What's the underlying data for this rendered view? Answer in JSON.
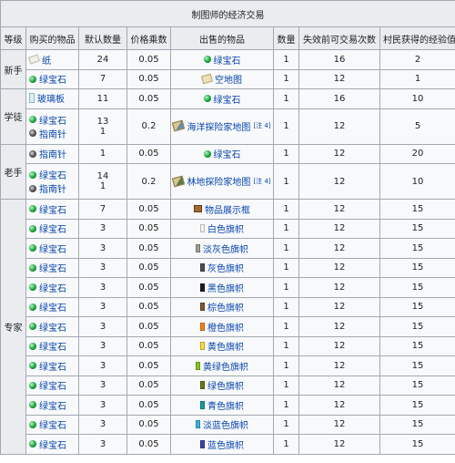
{
  "caption": "制图师的经济交易",
  "headers": [
    "等级",
    "购买的物品",
    "默认数量",
    "价格乘数",
    "出售的物品",
    "数量",
    "失效前可交易次数",
    "村民获得的经验值"
  ],
  "rows": [
    {
      "level": "新手",
      "buy": [
        {
          "name": "纸",
          "icon": "paper-icon",
          "qty": "24"
        }
      ],
      "mult": "0.05",
      "sell": {
        "name": "绿宝石",
        "icon": "emerald-icon"
      },
      "sell_qty": "1",
      "max_uses": "16",
      "xp": "2"
    },
    {
      "buy": [
        {
          "name": "绿宝石",
          "icon": "emerald-icon",
          "qty": "7"
        }
      ],
      "mult": "0.05",
      "sell": {
        "name": "空地图",
        "icon": "empty-map-icon"
      },
      "sell_qty": "1",
      "max_uses": "12",
      "xp": "1"
    },
    {
      "level": "学徒",
      "buy": [
        {
          "name": "玻璃板",
          "icon": "glass-pane-icon",
          "qty": "11"
        }
      ],
      "mult": "0.05",
      "sell": {
        "name": "绿宝石",
        "icon": "emerald-icon"
      },
      "sell_qty": "1",
      "max_uses": "16",
      "xp": "10"
    },
    {
      "buy": [
        {
          "name": "绿宝石",
          "icon": "emerald-icon",
          "qty": "13"
        },
        {
          "name": "指南针",
          "icon": "compass-icon",
          "qty": "1"
        }
      ],
      "mult": "0.2",
      "sell": {
        "name": "海洋探险家地图",
        "icon": "ocean-explorer-map-icon",
        "note": "[注 4]"
      },
      "sell_qty": "1",
      "max_uses": "12",
      "xp": "5"
    },
    {
      "level": "老手",
      "buy": [
        {
          "name": "指南针",
          "icon": "compass-icon",
          "qty": "1"
        }
      ],
      "mult": "0.05",
      "sell": {
        "name": "绿宝石",
        "icon": "emerald-icon"
      },
      "sell_qty": "1",
      "max_uses": "12",
      "xp": "20"
    },
    {
      "buy": [
        {
          "name": "绿宝石",
          "icon": "emerald-icon",
          "qty": "14"
        },
        {
          "name": "指南针",
          "icon": "compass-icon",
          "qty": "1"
        }
      ],
      "mult": "0.2",
      "sell": {
        "name": "林地探险家地图",
        "icon": "woodland-explorer-map-icon",
        "note": "[注 4]"
      },
      "sell_qty": "1",
      "max_uses": "12",
      "xp": "10"
    },
    {
      "level": "专家",
      "buy": [
        {
          "name": "绿宝石",
          "icon": "emerald-icon",
          "qty": "7"
        }
      ],
      "mult": "0.05",
      "sell": {
        "name": "物品展示框",
        "icon": "item-frame-icon"
      },
      "sell_qty": "1",
      "max_uses": "12",
      "xp": "15"
    },
    {
      "buy": [
        {
          "name": "绿宝石",
          "icon": "emerald-icon",
          "qty": "3"
        }
      ],
      "mult": "0.05",
      "sell": {
        "name": "白色旗帜",
        "icon": "white-banner-icon",
        "color": "#f4f4f4"
      },
      "sell_qty": "1",
      "max_uses": "12",
      "xp": "15"
    },
    {
      "buy": [
        {
          "name": "绿宝石",
          "icon": "emerald-icon",
          "qty": "3"
        }
      ],
      "mult": "0.05",
      "sell": {
        "name": "淡灰色旗帜",
        "icon": "light-gray-banner-icon",
        "color": "#9d9d97"
      },
      "sell_qty": "1",
      "max_uses": "12",
      "xp": "15"
    },
    {
      "buy": [
        {
          "name": "绿宝石",
          "icon": "emerald-icon",
          "qty": "3"
        }
      ],
      "mult": "0.05",
      "sell": {
        "name": "灰色旗帜",
        "icon": "gray-banner-icon",
        "color": "#474f52"
      },
      "sell_qty": "1",
      "max_uses": "12",
      "xp": "15"
    },
    {
      "buy": [
        {
          "name": "绿宝石",
          "icon": "emerald-icon",
          "qty": "3"
        }
      ],
      "mult": "0.05",
      "sell": {
        "name": "黑色旗帜",
        "icon": "black-banner-icon",
        "color": "#1d1d21"
      },
      "sell_qty": "1",
      "max_uses": "12",
      "xp": "15"
    },
    {
      "buy": [
        {
          "name": "绿宝石",
          "icon": "emerald-icon",
          "qty": "3"
        }
      ],
      "mult": "0.05",
      "sell": {
        "name": "棕色旗帜",
        "icon": "brown-banner-icon",
        "color": "#835432"
      },
      "sell_qty": "1",
      "max_uses": "12",
      "xp": "15"
    },
    {
      "buy": [
        {
          "name": "绿宝石",
          "icon": "emerald-icon",
          "qty": "3"
        }
      ],
      "mult": "0.05",
      "sell": {
        "name": "橙色旗帜",
        "icon": "orange-banner-icon",
        "color": "#f9801d"
      },
      "sell_qty": "1",
      "max_uses": "12",
      "xp": "15"
    },
    {
      "buy": [
        {
          "name": "绿宝石",
          "icon": "emerald-icon",
          "qty": "3"
        }
      ],
      "mult": "0.05",
      "sell": {
        "name": "黄色旗帜",
        "icon": "yellow-banner-icon",
        "color": "#fed83d"
      },
      "sell_qty": "1",
      "max_uses": "12",
      "xp": "15"
    },
    {
      "buy": [
        {
          "name": "绿宝石",
          "icon": "emerald-icon",
          "qty": "3"
        }
      ],
      "mult": "0.05",
      "sell": {
        "name": "黄绿色旗帜",
        "icon": "lime-banner-icon",
        "color": "#80c71f"
      },
      "sell_qty": "1",
      "max_uses": "12",
      "xp": "15"
    },
    {
      "buy": [
        {
          "name": "绿宝石",
          "icon": "emerald-icon",
          "qty": "3"
        }
      ],
      "mult": "0.05",
      "sell": {
        "name": "绿色旗帜",
        "icon": "green-banner-icon",
        "color": "#5e7c16"
      },
      "sell_qty": "1",
      "max_uses": "12",
      "xp": "15"
    },
    {
      "buy": [
        {
          "name": "绿宝石",
          "icon": "emerald-icon",
          "qty": "3"
        }
      ],
      "mult": "0.05",
      "sell": {
        "name": "青色旗帜",
        "icon": "cyan-banner-icon",
        "color": "#169c9c"
      },
      "sell_qty": "1",
      "max_uses": "12",
      "xp": "15"
    },
    {
      "buy": [
        {
          "name": "绿宝石",
          "icon": "emerald-icon",
          "qty": "3"
        }
      ],
      "mult": "0.05",
      "sell": {
        "name": "淡蓝色旗帜",
        "icon": "light-blue-banner-icon",
        "color": "#3ab3da"
      },
      "sell_qty": "1",
      "max_uses": "12",
      "xp": "15"
    },
    {
      "buy": [
        {
          "name": "绿宝石",
          "icon": "emerald-icon",
          "qty": "3"
        }
      ],
      "mult": "0.05",
      "sell": {
        "name": "蓝色旗帜",
        "icon": "blue-banner-icon",
        "color": "#3c44aa"
      },
      "sell_qty": "1",
      "max_uses": "12",
      "xp": "15"
    }
  ],
  "level_spans": [
    2,
    2,
    2,
    13
  ],
  "colors": {
    "link": "#0645ad",
    "header_bg": "#eaecf0",
    "cell_bg": "#f8f9fa",
    "border": "#a2a9b1"
  }
}
